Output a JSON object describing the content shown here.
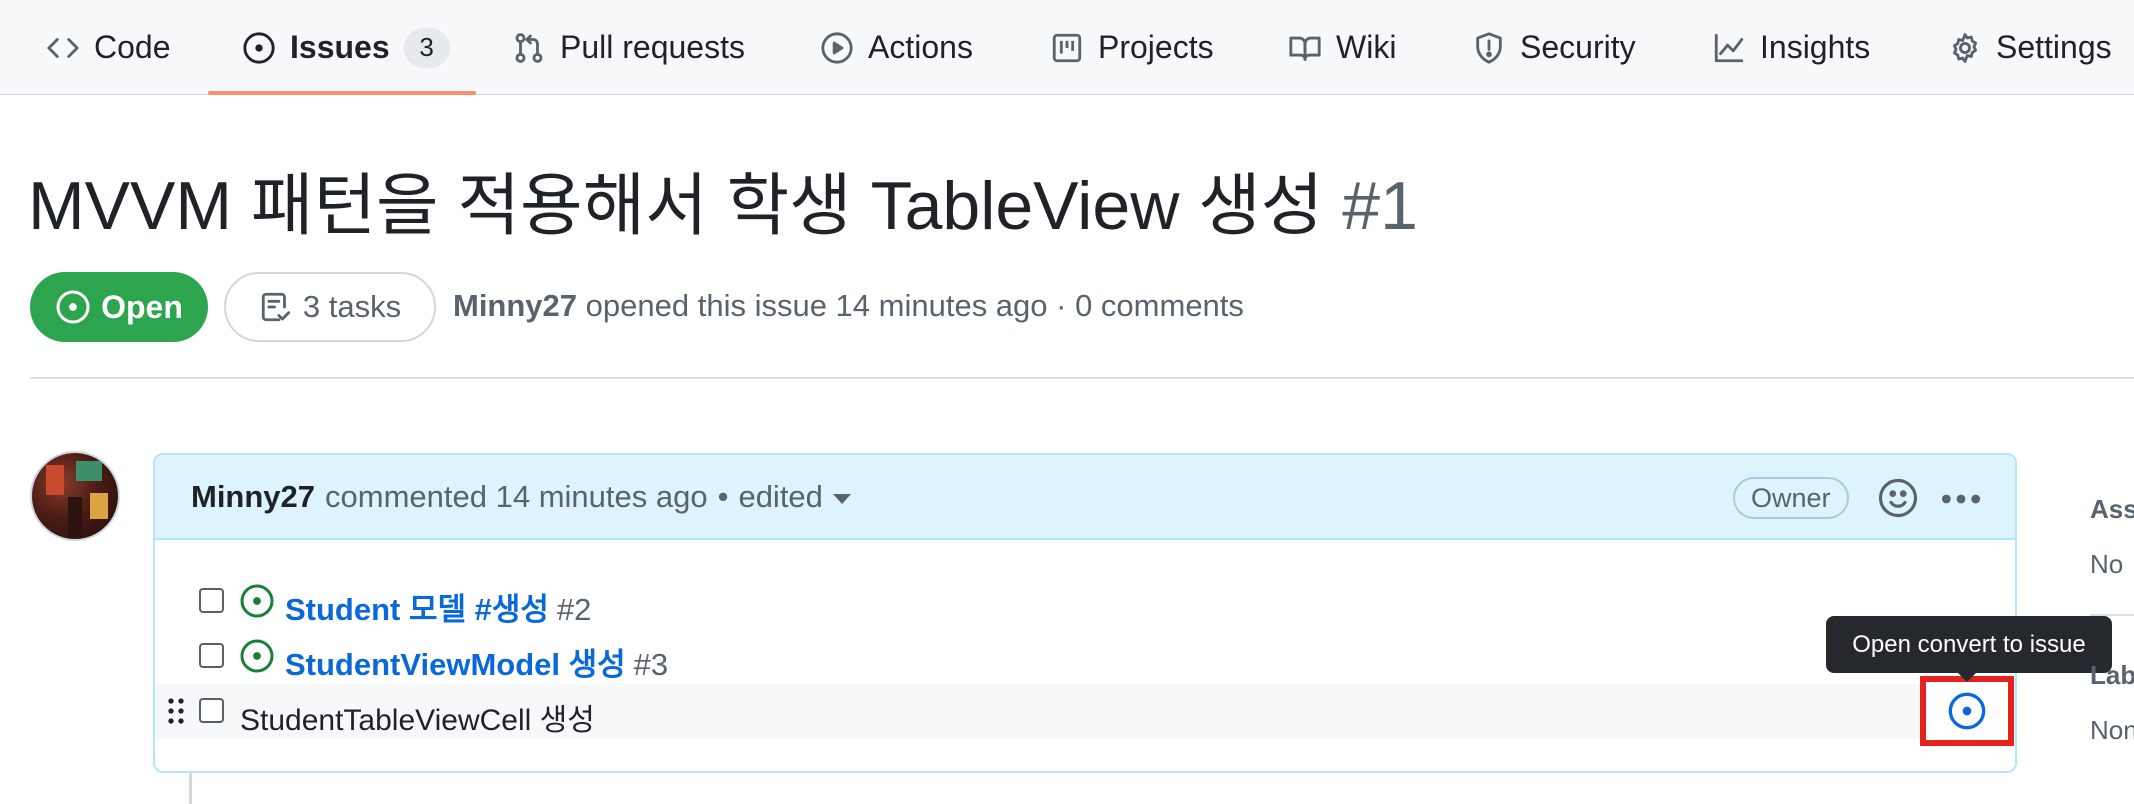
{
  "nav": {
    "items": [
      {
        "label": "Code",
        "icon": "code-icon"
      },
      {
        "label": "Issues",
        "icon": "issue-opened-icon",
        "counter": "3",
        "selected": true
      },
      {
        "label": "Pull requests",
        "icon": "git-pull-request-icon"
      },
      {
        "label": "Actions",
        "icon": "play-icon"
      },
      {
        "label": "Projects",
        "icon": "table-icon"
      },
      {
        "label": "Wiki",
        "icon": "book-icon"
      },
      {
        "label": "Security",
        "icon": "shield-icon"
      },
      {
        "label": "Insights",
        "icon": "graph-icon"
      },
      {
        "label": "Settings",
        "icon": "gear-icon"
      }
    ],
    "accent_underline": "#fd8c73"
  },
  "issue": {
    "title": "MVVM 패턴을 적용해서 학생 TableView 생성",
    "number": "#1",
    "state": "Open",
    "state_color": "#2da44e",
    "tasks": "3 tasks",
    "author": "Minny27",
    "meta_text": "opened this issue 14 minutes ago · 0 comments"
  },
  "comment": {
    "author": "Minny27",
    "action_text": "commented 14 minutes ago",
    "bullet": "•",
    "edited": "edited",
    "owner_label": "Owner",
    "header_color": "#ddf4ff",
    "tasks": [
      {
        "text": "Student 모델 #생성",
        "number": "#2",
        "tracked": true
      },
      {
        "text": "StudentViewModel 생성",
        "number": "#3",
        "tracked": true
      },
      {
        "text": "StudentTableViewCell 생성",
        "number": "",
        "tracked": false
      }
    ]
  },
  "tooltip": {
    "text": "Open convert to issue"
  },
  "highlight_color": "#e5221d",
  "sidebar": {
    "assignees_heading": "Ass",
    "assignees_value": "No",
    "labels_heading": "Lab",
    "labels_value": "Non"
  }
}
